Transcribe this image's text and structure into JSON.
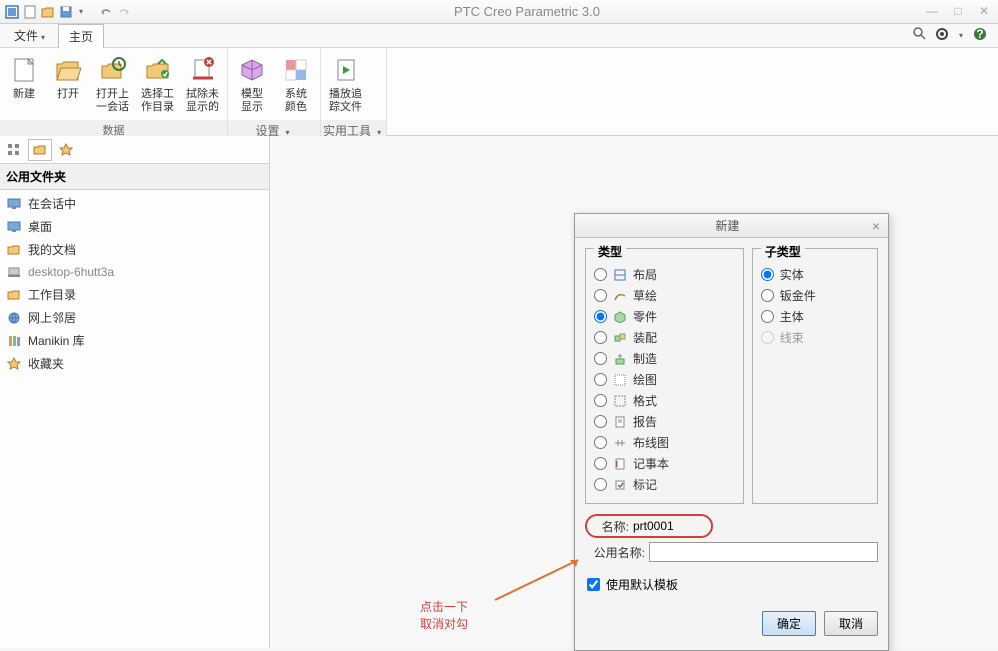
{
  "app": {
    "title": "PTC Creo Parametric 3.0"
  },
  "menu": {
    "file": "文件",
    "home": "主页"
  },
  "ribbon": {
    "new": "新建",
    "open": "打开",
    "open_last": "打开上\n一会话",
    "select_workdir": "选择工\n作目录",
    "erase_undisplayed": "拭除未\n显示的",
    "model_display": "模型\n显示",
    "system_colors": "系统\n颜色",
    "play_trail": "播放追\n踪文件",
    "group_data": "数据",
    "group_settings": "设置",
    "group_utilities": "实用工具"
  },
  "sidebar": {
    "header": "公用文件夹",
    "items": [
      {
        "label": "在会话中"
      },
      {
        "label": "桌面"
      },
      {
        "label": "我的文档"
      },
      {
        "label": "desktop-6hutt3a"
      },
      {
        "label": "工作目录"
      },
      {
        "label": "网上邻居"
      },
      {
        "label": "Manikin 库"
      },
      {
        "label": "收藏夹"
      }
    ]
  },
  "dialog": {
    "title": "新建",
    "type_legend": "类型",
    "subtype_legend": "子类型",
    "types": [
      {
        "label": "布局"
      },
      {
        "label": "草绘"
      },
      {
        "label": "零件"
      },
      {
        "label": "装配"
      },
      {
        "label": "制造"
      },
      {
        "label": "绘图"
      },
      {
        "label": "格式"
      },
      {
        "label": "报告"
      },
      {
        "label": "布线图"
      },
      {
        "label": "记事本"
      },
      {
        "label": "标记"
      }
    ],
    "subtypes": [
      {
        "label": "实体"
      },
      {
        "label": "钣金件"
      },
      {
        "label": "主体"
      },
      {
        "label": "线束"
      }
    ],
    "name_label": "名称:",
    "name_value": "prt0001",
    "common_name_label": "公用名称:",
    "common_name_value": "",
    "default_template": "使用默认模板",
    "ok": "确定",
    "cancel": "取消"
  },
  "annotation": {
    "line1": "点击一下",
    "line2": "取消对勾"
  }
}
